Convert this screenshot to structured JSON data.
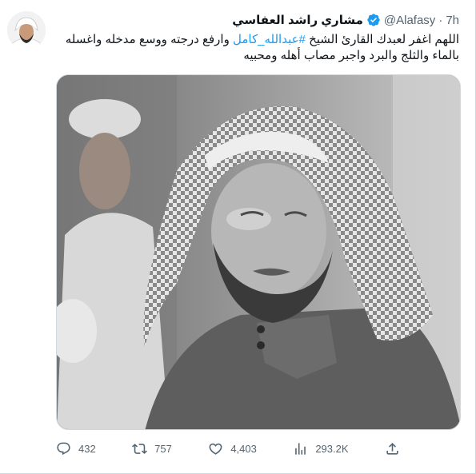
{
  "tweet": {
    "author_name": "مشاري راشد العفاسي",
    "handle": "@Alafasy",
    "separator": "·",
    "time": "7h",
    "text_part1": "اللهم اغفر لعبدك القارئ الشيخ ",
    "hashtag": "#عبدالله_كامل",
    "text_part2": " وارفع درجته ووسع مدخله واغسله بالماء والثلج والبرد واجبر مصاب أهله ومحبيه"
  },
  "actions": {
    "replies": "432",
    "retweets": "757",
    "likes": "4,403",
    "views": "293.2K"
  },
  "colors": {
    "text": "#0f1419",
    "muted": "#536471",
    "link": "#1d9bf0",
    "verified": "#1d9bf0",
    "border": "#cfd9de"
  },
  "icons": {
    "verified": "verified-badge-icon",
    "reply": "reply-icon",
    "retweet": "retweet-icon",
    "like": "heart-icon",
    "views": "analytics-icon",
    "share": "share-icon"
  }
}
